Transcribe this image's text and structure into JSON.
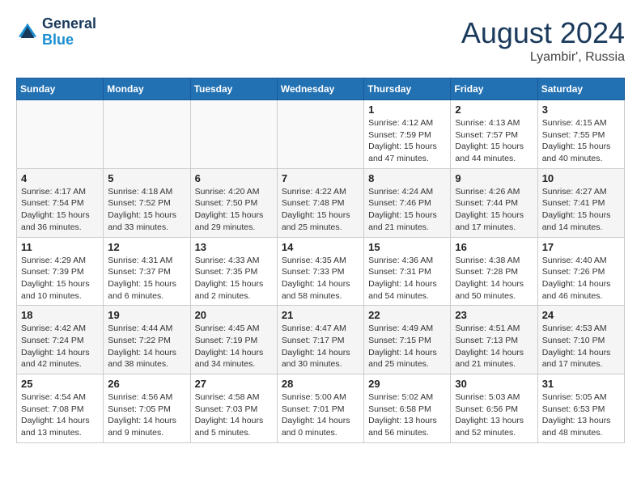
{
  "header": {
    "logo_line1": "General",
    "logo_line2": "Blue",
    "month_title": "August 2024",
    "location": "Lyambir', Russia"
  },
  "weekdays": [
    "Sunday",
    "Monday",
    "Tuesday",
    "Wednesday",
    "Thursday",
    "Friday",
    "Saturday"
  ],
  "weeks": [
    [
      {
        "day": "",
        "content": ""
      },
      {
        "day": "",
        "content": ""
      },
      {
        "day": "",
        "content": ""
      },
      {
        "day": "",
        "content": ""
      },
      {
        "day": "1",
        "content": "Sunrise: 4:12 AM\nSunset: 7:59 PM\nDaylight: 15 hours\nand 47 minutes."
      },
      {
        "day": "2",
        "content": "Sunrise: 4:13 AM\nSunset: 7:57 PM\nDaylight: 15 hours\nand 44 minutes."
      },
      {
        "day": "3",
        "content": "Sunrise: 4:15 AM\nSunset: 7:55 PM\nDaylight: 15 hours\nand 40 minutes."
      }
    ],
    [
      {
        "day": "4",
        "content": "Sunrise: 4:17 AM\nSunset: 7:54 PM\nDaylight: 15 hours\nand 36 minutes."
      },
      {
        "day": "5",
        "content": "Sunrise: 4:18 AM\nSunset: 7:52 PM\nDaylight: 15 hours\nand 33 minutes."
      },
      {
        "day": "6",
        "content": "Sunrise: 4:20 AM\nSunset: 7:50 PM\nDaylight: 15 hours\nand 29 minutes."
      },
      {
        "day": "7",
        "content": "Sunrise: 4:22 AM\nSunset: 7:48 PM\nDaylight: 15 hours\nand 25 minutes."
      },
      {
        "day": "8",
        "content": "Sunrise: 4:24 AM\nSunset: 7:46 PM\nDaylight: 15 hours\nand 21 minutes."
      },
      {
        "day": "9",
        "content": "Sunrise: 4:26 AM\nSunset: 7:44 PM\nDaylight: 15 hours\nand 17 minutes."
      },
      {
        "day": "10",
        "content": "Sunrise: 4:27 AM\nSunset: 7:41 PM\nDaylight: 15 hours\nand 14 minutes."
      }
    ],
    [
      {
        "day": "11",
        "content": "Sunrise: 4:29 AM\nSunset: 7:39 PM\nDaylight: 15 hours\nand 10 minutes."
      },
      {
        "day": "12",
        "content": "Sunrise: 4:31 AM\nSunset: 7:37 PM\nDaylight: 15 hours\nand 6 minutes."
      },
      {
        "day": "13",
        "content": "Sunrise: 4:33 AM\nSunset: 7:35 PM\nDaylight: 15 hours\nand 2 minutes."
      },
      {
        "day": "14",
        "content": "Sunrise: 4:35 AM\nSunset: 7:33 PM\nDaylight: 14 hours\nand 58 minutes."
      },
      {
        "day": "15",
        "content": "Sunrise: 4:36 AM\nSunset: 7:31 PM\nDaylight: 14 hours\nand 54 minutes."
      },
      {
        "day": "16",
        "content": "Sunrise: 4:38 AM\nSunset: 7:28 PM\nDaylight: 14 hours\nand 50 minutes."
      },
      {
        "day": "17",
        "content": "Sunrise: 4:40 AM\nSunset: 7:26 PM\nDaylight: 14 hours\nand 46 minutes."
      }
    ],
    [
      {
        "day": "18",
        "content": "Sunrise: 4:42 AM\nSunset: 7:24 PM\nDaylight: 14 hours\nand 42 minutes."
      },
      {
        "day": "19",
        "content": "Sunrise: 4:44 AM\nSunset: 7:22 PM\nDaylight: 14 hours\nand 38 minutes."
      },
      {
        "day": "20",
        "content": "Sunrise: 4:45 AM\nSunset: 7:19 PM\nDaylight: 14 hours\nand 34 minutes."
      },
      {
        "day": "21",
        "content": "Sunrise: 4:47 AM\nSunset: 7:17 PM\nDaylight: 14 hours\nand 30 minutes."
      },
      {
        "day": "22",
        "content": "Sunrise: 4:49 AM\nSunset: 7:15 PM\nDaylight: 14 hours\nand 25 minutes."
      },
      {
        "day": "23",
        "content": "Sunrise: 4:51 AM\nSunset: 7:13 PM\nDaylight: 14 hours\nand 21 minutes."
      },
      {
        "day": "24",
        "content": "Sunrise: 4:53 AM\nSunset: 7:10 PM\nDaylight: 14 hours\nand 17 minutes."
      }
    ],
    [
      {
        "day": "25",
        "content": "Sunrise: 4:54 AM\nSunset: 7:08 PM\nDaylight: 14 hours\nand 13 minutes."
      },
      {
        "day": "26",
        "content": "Sunrise: 4:56 AM\nSunset: 7:05 PM\nDaylight: 14 hours\nand 9 minutes."
      },
      {
        "day": "27",
        "content": "Sunrise: 4:58 AM\nSunset: 7:03 PM\nDaylight: 14 hours\nand 5 minutes."
      },
      {
        "day": "28",
        "content": "Sunrise: 5:00 AM\nSunset: 7:01 PM\nDaylight: 14 hours\nand 0 minutes."
      },
      {
        "day": "29",
        "content": "Sunrise: 5:02 AM\nSunset: 6:58 PM\nDaylight: 13 hours\nand 56 minutes."
      },
      {
        "day": "30",
        "content": "Sunrise: 5:03 AM\nSunset: 6:56 PM\nDaylight: 13 hours\nand 52 minutes."
      },
      {
        "day": "31",
        "content": "Sunrise: 5:05 AM\nSunset: 6:53 PM\nDaylight: 13 hours\nand 48 minutes."
      }
    ]
  ]
}
